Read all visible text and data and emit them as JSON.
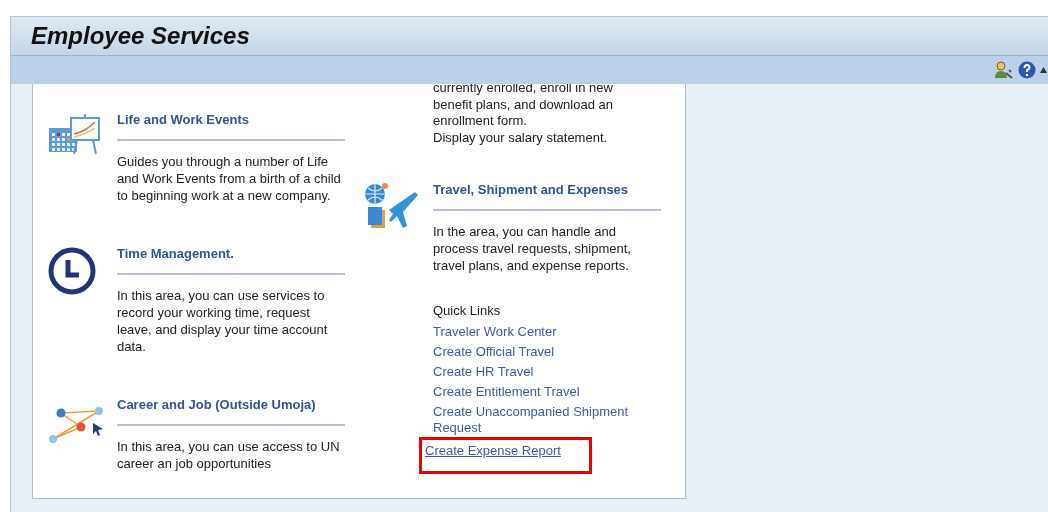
{
  "header": {
    "title": "Employee Services"
  },
  "columns": [
    {
      "sections": [
        {
          "kind": "events",
          "title": "Life and Work Events",
          "description": "Guides you through a number of Life and Work Events from a birth of a child to beginning work at a new company."
        },
        {
          "kind": "clock",
          "title": "Time Management.",
          "description": "In this area, you can use services to record your working time, request leave, and display your time account data."
        },
        {
          "kind": "career",
          "title": "Career and Job (Outside Umoja)",
          "description": "In this area, you can use access to UN career an job opportunities"
        }
      ]
    },
    {
      "continued": [
        "currently enrolled, enroll in new",
        "benefit plans, and download an",
        "enrollment form.",
        "Display your salary statement."
      ],
      "sections": [
        {
          "kind": "travel",
          "title": "Travel, Shipment and Expenses",
          "description": "In the area, you can handle and process travel requests, shipment, travel plans, and expense reports.",
          "quick_links": {
            "heading": "Quick Links",
            "links": [
              {
                "label": "Traveler Work Center",
                "highlighted": false
              },
              {
                "label": "Create Official Travel",
                "highlighted": false
              },
              {
                "label": "Create HR Travel",
                "highlighted": false
              },
              {
                "label": "Create Entitlement Travel",
                "highlighted": false
              },
              {
                "label": "Create Unaccompanied Shipment Request",
                "highlighted": false
              },
              {
                "label": "Create Expense Report",
                "highlighted": true
              }
            ]
          }
        }
      ]
    }
  ]
}
